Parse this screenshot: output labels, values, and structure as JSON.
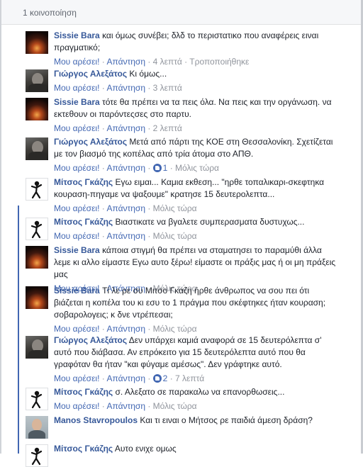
{
  "share_count": "1 κοινοποίηση",
  "actions": {
    "like": "Μου αρέσει!",
    "reply": "Απάντηση",
    "edited": "Τροποποιήθηκε"
  },
  "comments": [
    {
      "author": "Sissie Bara",
      "text": "και όμως συνέβει; δλδ το περιστατικο που αναφέρεις ειναι πραγματικό;",
      "time": "4 λεπτά"
    },
    {
      "author": "Γιώργος Αλεξάτος",
      "text": "Κι όμως...",
      "time": "3 λεπτά"
    },
    {
      "author": "Sissie Bara",
      "text": "τότε θα πρέπει να τα πεις όλα. Να πεις και την οργάνωση. να εκτεθουν οι παρόντεςσες στο παρτυ.",
      "time": "2 λεπτά"
    },
    {
      "author": "Γιώργος Αλεξάτος",
      "text": "Μετά από πάρτι της ΚΟΕ στη Θεσσαλονίκη. Σχετίζεται με τον βιασμό της κοπέλας από τρία άτομα στο ΑΠΘ.",
      "likes": "1",
      "time": "Μόλις τώρα"
    },
    {
      "author": "Μίτσος Γκάζης",
      "text": "Εγω ειμαι... Καμια εκθεση... \"ηρθε τοπαλικαρι-σκεφτηκα κουραση-πηγαμε να ψαξουμε\" κρατησε 15 δευτερολεπτα...",
      "time": "Μόλις τώρα"
    },
    {
      "author": "Μίτσος Γκάζης",
      "text": "Βιαστικατε να βγαλετε συμπερασματα δυστυχως...",
      "time": "Μόλις τώρα"
    },
    {
      "author": "Sissie Bara",
      "text": "κάποια στιγμή θα πρέπει να σταματησει το παραμύθι άλλα λεμε κι αλλο είμαστε Εγω αυτο ξέρω! είμαστε οι πράξις μας ή οι μη πράξεις μας",
      "time": "Μόλις τώρα"
    },
    {
      "author": "Sissie Bara",
      "text": "Τί λε ρε συ Μιτσο Γκαζη ήρθε άνθρωπος να σου πει ότι βιάζεται η κοπέλα του κι εσυ το 1 πράγμα που σκέφτηκες ήταν κουραση; σοβαρολογεις; κ δνε ντρέπεσαι;",
      "time": "Μόλις τώρα"
    },
    {
      "author": "Γιώργος Αλεξάτος",
      "text": "Δεν υπάρχει καμιά αναφορά σε 15 δευτερόλεπτα σ' αυτό που διάβασα. Αν επρόκειτο για 15 δευτερόλεπτα αυτό που θα γραφόταν θα ήταν \"και φύγαμε αμέσως\". Δεν γράφτηκε αυτό.",
      "likes": "2",
      "time": "7 λεπτά"
    },
    {
      "author": "Μίτσος Γκάζης",
      "text": "σ. Αλεξατο σε παρακαλω να επανορθωσεις...",
      "time": "Μόλις τώρα"
    },
    {
      "author": "Manos Stavropoulos",
      "text": "Και τι ειναι ο Μήτσος ρε παιδιά άμεση δράση?"
    },
    {
      "author": "Μίτσος Γκάζης",
      "text": "Αυτο ενιχε ομως"
    }
  ]
}
